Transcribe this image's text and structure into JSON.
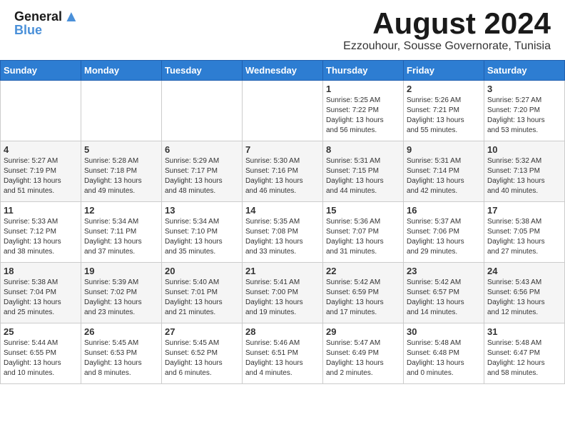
{
  "header": {
    "logo_line1": "General",
    "logo_line2": "Blue",
    "month": "August 2024",
    "location": "Ezzouhour, Sousse Governorate, Tunisia"
  },
  "weekdays": [
    "Sunday",
    "Monday",
    "Tuesday",
    "Wednesday",
    "Thursday",
    "Friday",
    "Saturday"
  ],
  "weeks": [
    [
      {
        "day": "",
        "info": ""
      },
      {
        "day": "",
        "info": ""
      },
      {
        "day": "",
        "info": ""
      },
      {
        "day": "",
        "info": ""
      },
      {
        "day": "1",
        "info": "Sunrise: 5:25 AM\nSunset: 7:22 PM\nDaylight: 13 hours\nand 56 minutes."
      },
      {
        "day": "2",
        "info": "Sunrise: 5:26 AM\nSunset: 7:21 PM\nDaylight: 13 hours\nand 55 minutes."
      },
      {
        "day": "3",
        "info": "Sunrise: 5:27 AM\nSunset: 7:20 PM\nDaylight: 13 hours\nand 53 minutes."
      }
    ],
    [
      {
        "day": "4",
        "info": "Sunrise: 5:27 AM\nSunset: 7:19 PM\nDaylight: 13 hours\nand 51 minutes."
      },
      {
        "day": "5",
        "info": "Sunrise: 5:28 AM\nSunset: 7:18 PM\nDaylight: 13 hours\nand 49 minutes."
      },
      {
        "day": "6",
        "info": "Sunrise: 5:29 AM\nSunset: 7:17 PM\nDaylight: 13 hours\nand 48 minutes."
      },
      {
        "day": "7",
        "info": "Sunrise: 5:30 AM\nSunset: 7:16 PM\nDaylight: 13 hours\nand 46 minutes."
      },
      {
        "day": "8",
        "info": "Sunrise: 5:31 AM\nSunset: 7:15 PM\nDaylight: 13 hours\nand 44 minutes."
      },
      {
        "day": "9",
        "info": "Sunrise: 5:31 AM\nSunset: 7:14 PM\nDaylight: 13 hours\nand 42 minutes."
      },
      {
        "day": "10",
        "info": "Sunrise: 5:32 AM\nSunset: 7:13 PM\nDaylight: 13 hours\nand 40 minutes."
      }
    ],
    [
      {
        "day": "11",
        "info": "Sunrise: 5:33 AM\nSunset: 7:12 PM\nDaylight: 13 hours\nand 38 minutes."
      },
      {
        "day": "12",
        "info": "Sunrise: 5:34 AM\nSunset: 7:11 PM\nDaylight: 13 hours\nand 37 minutes."
      },
      {
        "day": "13",
        "info": "Sunrise: 5:34 AM\nSunset: 7:10 PM\nDaylight: 13 hours\nand 35 minutes."
      },
      {
        "day": "14",
        "info": "Sunrise: 5:35 AM\nSunset: 7:08 PM\nDaylight: 13 hours\nand 33 minutes."
      },
      {
        "day": "15",
        "info": "Sunrise: 5:36 AM\nSunset: 7:07 PM\nDaylight: 13 hours\nand 31 minutes."
      },
      {
        "day": "16",
        "info": "Sunrise: 5:37 AM\nSunset: 7:06 PM\nDaylight: 13 hours\nand 29 minutes."
      },
      {
        "day": "17",
        "info": "Sunrise: 5:38 AM\nSunset: 7:05 PM\nDaylight: 13 hours\nand 27 minutes."
      }
    ],
    [
      {
        "day": "18",
        "info": "Sunrise: 5:38 AM\nSunset: 7:04 PM\nDaylight: 13 hours\nand 25 minutes."
      },
      {
        "day": "19",
        "info": "Sunrise: 5:39 AM\nSunset: 7:02 PM\nDaylight: 13 hours\nand 23 minutes."
      },
      {
        "day": "20",
        "info": "Sunrise: 5:40 AM\nSunset: 7:01 PM\nDaylight: 13 hours\nand 21 minutes."
      },
      {
        "day": "21",
        "info": "Sunrise: 5:41 AM\nSunset: 7:00 PM\nDaylight: 13 hours\nand 19 minutes."
      },
      {
        "day": "22",
        "info": "Sunrise: 5:42 AM\nSunset: 6:59 PM\nDaylight: 13 hours\nand 17 minutes."
      },
      {
        "day": "23",
        "info": "Sunrise: 5:42 AM\nSunset: 6:57 PM\nDaylight: 13 hours\nand 14 minutes."
      },
      {
        "day": "24",
        "info": "Sunrise: 5:43 AM\nSunset: 6:56 PM\nDaylight: 13 hours\nand 12 minutes."
      }
    ],
    [
      {
        "day": "25",
        "info": "Sunrise: 5:44 AM\nSunset: 6:55 PM\nDaylight: 13 hours\nand 10 minutes."
      },
      {
        "day": "26",
        "info": "Sunrise: 5:45 AM\nSunset: 6:53 PM\nDaylight: 13 hours\nand 8 minutes."
      },
      {
        "day": "27",
        "info": "Sunrise: 5:45 AM\nSunset: 6:52 PM\nDaylight: 13 hours\nand 6 minutes."
      },
      {
        "day": "28",
        "info": "Sunrise: 5:46 AM\nSunset: 6:51 PM\nDaylight: 13 hours\nand 4 minutes."
      },
      {
        "day": "29",
        "info": "Sunrise: 5:47 AM\nSunset: 6:49 PM\nDaylight: 13 hours\nand 2 minutes."
      },
      {
        "day": "30",
        "info": "Sunrise: 5:48 AM\nSunset: 6:48 PM\nDaylight: 13 hours\nand 0 minutes."
      },
      {
        "day": "31",
        "info": "Sunrise: 5:48 AM\nSunset: 6:47 PM\nDaylight: 12 hours\nand 58 minutes."
      }
    ]
  ]
}
